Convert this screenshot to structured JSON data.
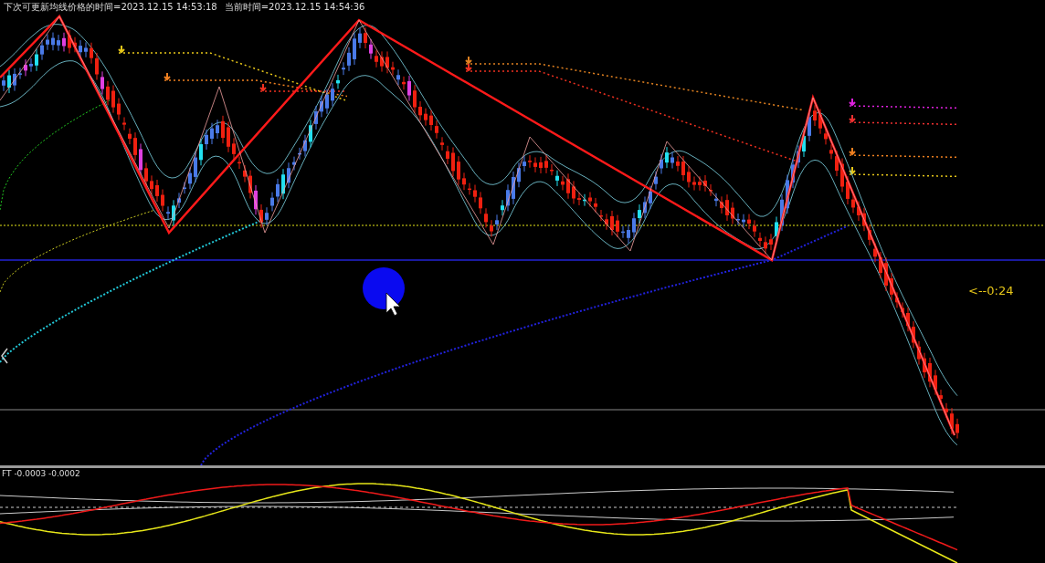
{
  "main_chart": {
    "info_texts": [
      "下次可更新均线价格的时间=2023.12.15 14:53:18",
      "当前时间=2023.12.15 14:54:36"
    ],
    "countdown": "<--0:24"
  },
  "indicator_window": {
    "label": "FT -0.0003 -0.0002"
  }
}
